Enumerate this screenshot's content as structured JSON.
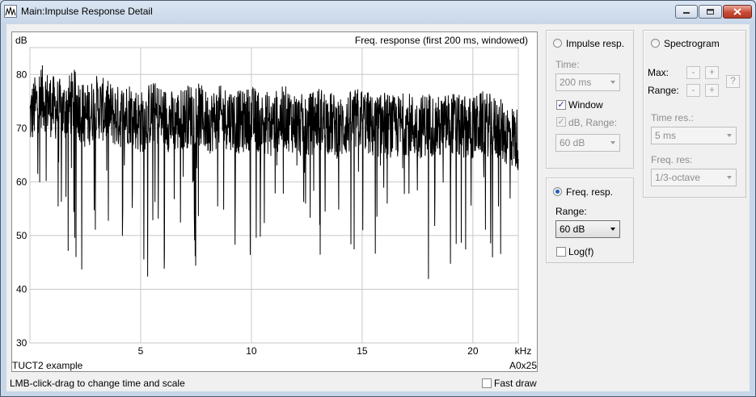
{
  "window": {
    "title": "Main:Impulse Response Detail",
    "controls": [
      "minimize",
      "maximize",
      "close"
    ]
  },
  "plot": {
    "y_unit": "dB",
    "title": "Freq. response  (first 200 ms, windowed)",
    "footer_left": "TUCT2 example",
    "footer_right": "A0x25"
  },
  "impulse_group": {
    "radio_label": "Impulse resp.",
    "selected": false,
    "time_label": "Time:",
    "time_value": "200 ms",
    "window_label": "Window",
    "window_checked": true,
    "db_range_label": "dB, Range:",
    "db_range_checked": true,
    "db_range_value": "60 dB"
  },
  "freq_group": {
    "radio_label": "Freq. resp.",
    "selected": true,
    "range_label": "Range:",
    "range_value": "60 dB",
    "log_label": "Log(f)",
    "log_checked": false
  },
  "spectrogram_group": {
    "radio_label": "Spectrogram",
    "selected": false,
    "max_label": "Max:",
    "range_label": "Range:",
    "minus": "-",
    "plus": "+",
    "help": "?",
    "time_res_label": "Time res.:",
    "time_res_value": "5 ms",
    "freq_res_label": "Freq. res:",
    "freq_res_value": "1/3-octave"
  },
  "status": {
    "hint": "LMB-click-drag to change time and scale",
    "fast_draw_label": "Fast draw",
    "fast_draw_checked": false
  },
  "chart_data": {
    "type": "line",
    "title": "Freq. response  (first 200 ms, windowed)",
    "xlabel": "kHz",
    "ylabel": "dB",
    "xlim": [
      0,
      22.05
    ],
    "ylim": [
      30,
      85
    ],
    "x_ticks": [
      5,
      10,
      15,
      20
    ],
    "y_ticks": [
      30,
      40,
      50,
      60,
      70,
      80
    ],
    "grid": true,
    "series": [
      {
        "x": [
          0,
          0.5,
          1,
          1.5,
          2,
          2.5,
          3,
          3.5,
          4,
          4.5,
          5,
          5.5,
          6,
          6.5,
          7,
          7.5,
          8,
          8.5,
          9,
          9.5,
          10,
          10.5,
          11,
          11.5,
          12,
          12.5,
          13,
          13.5,
          14,
          14.5,
          15,
          15.5,
          16,
          16.5,
          17,
          17.5,
          18,
          18.5,
          19,
          19.5,
          20,
          20.5,
          21,
          21.5,
          22
        ],
        "values": [
          72,
          76,
          74,
          73,
          75,
          72,
          74,
          73,
          72,
          73,
          71,
          73,
          72,
          71,
          72,
          73,
          71,
          72,
          72,
          71,
          72,
          71,
          71,
          72,
          71,
          70,
          72,
          71,
          70,
          71,
          72,
          70,
          71,
          70,
          71,
          70,
          71,
          70,
          71,
          70,
          70,
          71,
          70,
          69,
          68
        ]
      }
    ]
  }
}
